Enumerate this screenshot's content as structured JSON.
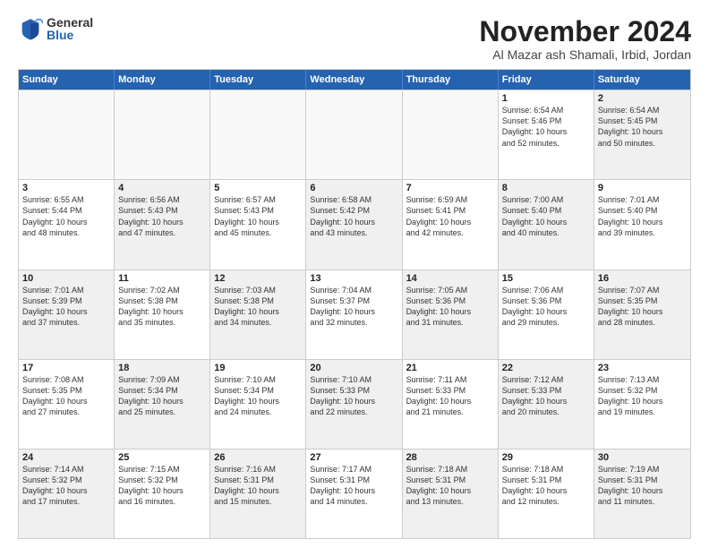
{
  "logo": {
    "general": "General",
    "blue": "Blue"
  },
  "title": "November 2024",
  "location": "Al Mazar ash Shamali, Irbid, Jordan",
  "headers": [
    "Sunday",
    "Monday",
    "Tuesday",
    "Wednesday",
    "Thursday",
    "Friday",
    "Saturday"
  ],
  "rows": [
    [
      {
        "day": "",
        "lines": [],
        "empty": true
      },
      {
        "day": "",
        "lines": [],
        "empty": true
      },
      {
        "day": "",
        "lines": [],
        "empty": true
      },
      {
        "day": "",
        "lines": [],
        "empty": true
      },
      {
        "day": "",
        "lines": [],
        "empty": true
      },
      {
        "day": "1",
        "lines": [
          "Sunrise: 6:54 AM",
          "Sunset: 5:46 PM",
          "Daylight: 10 hours",
          "and 52 minutes."
        ]
      },
      {
        "day": "2",
        "lines": [
          "Sunrise: 6:54 AM",
          "Sunset: 5:45 PM",
          "Daylight: 10 hours",
          "and 50 minutes."
        ],
        "shaded": true
      }
    ],
    [
      {
        "day": "3",
        "lines": [
          "Sunrise: 6:55 AM",
          "Sunset: 5:44 PM",
          "Daylight: 10 hours",
          "and 48 minutes."
        ]
      },
      {
        "day": "4",
        "lines": [
          "Sunrise: 6:56 AM",
          "Sunset: 5:43 PM",
          "Daylight: 10 hours",
          "and 47 minutes."
        ],
        "shaded": true
      },
      {
        "day": "5",
        "lines": [
          "Sunrise: 6:57 AM",
          "Sunset: 5:43 PM",
          "Daylight: 10 hours",
          "and 45 minutes."
        ]
      },
      {
        "day": "6",
        "lines": [
          "Sunrise: 6:58 AM",
          "Sunset: 5:42 PM",
          "Daylight: 10 hours",
          "and 43 minutes."
        ],
        "shaded": true
      },
      {
        "day": "7",
        "lines": [
          "Sunrise: 6:59 AM",
          "Sunset: 5:41 PM",
          "Daylight: 10 hours",
          "and 42 minutes."
        ]
      },
      {
        "day": "8",
        "lines": [
          "Sunrise: 7:00 AM",
          "Sunset: 5:40 PM",
          "Daylight: 10 hours",
          "and 40 minutes."
        ],
        "shaded": true
      },
      {
        "day": "9",
        "lines": [
          "Sunrise: 7:01 AM",
          "Sunset: 5:40 PM",
          "Daylight: 10 hours",
          "and 39 minutes."
        ]
      }
    ],
    [
      {
        "day": "10",
        "lines": [
          "Sunrise: 7:01 AM",
          "Sunset: 5:39 PM",
          "Daylight: 10 hours",
          "and 37 minutes."
        ],
        "shaded": true
      },
      {
        "day": "11",
        "lines": [
          "Sunrise: 7:02 AM",
          "Sunset: 5:38 PM",
          "Daylight: 10 hours",
          "and 35 minutes."
        ]
      },
      {
        "day": "12",
        "lines": [
          "Sunrise: 7:03 AM",
          "Sunset: 5:38 PM",
          "Daylight: 10 hours",
          "and 34 minutes."
        ],
        "shaded": true
      },
      {
        "day": "13",
        "lines": [
          "Sunrise: 7:04 AM",
          "Sunset: 5:37 PM",
          "Daylight: 10 hours",
          "and 32 minutes."
        ]
      },
      {
        "day": "14",
        "lines": [
          "Sunrise: 7:05 AM",
          "Sunset: 5:36 PM",
          "Daylight: 10 hours",
          "and 31 minutes."
        ],
        "shaded": true
      },
      {
        "day": "15",
        "lines": [
          "Sunrise: 7:06 AM",
          "Sunset: 5:36 PM",
          "Daylight: 10 hours",
          "and 29 minutes."
        ]
      },
      {
        "day": "16",
        "lines": [
          "Sunrise: 7:07 AM",
          "Sunset: 5:35 PM",
          "Daylight: 10 hours",
          "and 28 minutes."
        ],
        "shaded": true
      }
    ],
    [
      {
        "day": "17",
        "lines": [
          "Sunrise: 7:08 AM",
          "Sunset: 5:35 PM",
          "Daylight: 10 hours",
          "and 27 minutes."
        ]
      },
      {
        "day": "18",
        "lines": [
          "Sunrise: 7:09 AM",
          "Sunset: 5:34 PM",
          "Daylight: 10 hours",
          "and 25 minutes."
        ],
        "shaded": true
      },
      {
        "day": "19",
        "lines": [
          "Sunrise: 7:10 AM",
          "Sunset: 5:34 PM",
          "Daylight: 10 hours",
          "and 24 minutes."
        ]
      },
      {
        "day": "20",
        "lines": [
          "Sunrise: 7:10 AM",
          "Sunset: 5:33 PM",
          "Daylight: 10 hours",
          "and 22 minutes."
        ],
        "shaded": true
      },
      {
        "day": "21",
        "lines": [
          "Sunrise: 7:11 AM",
          "Sunset: 5:33 PM",
          "Daylight: 10 hours",
          "and 21 minutes."
        ]
      },
      {
        "day": "22",
        "lines": [
          "Sunrise: 7:12 AM",
          "Sunset: 5:33 PM",
          "Daylight: 10 hours",
          "and 20 minutes."
        ],
        "shaded": true
      },
      {
        "day": "23",
        "lines": [
          "Sunrise: 7:13 AM",
          "Sunset: 5:32 PM",
          "Daylight: 10 hours",
          "and 19 minutes."
        ]
      }
    ],
    [
      {
        "day": "24",
        "lines": [
          "Sunrise: 7:14 AM",
          "Sunset: 5:32 PM",
          "Daylight: 10 hours",
          "and 17 minutes."
        ],
        "shaded": true
      },
      {
        "day": "25",
        "lines": [
          "Sunrise: 7:15 AM",
          "Sunset: 5:32 PM",
          "Daylight: 10 hours",
          "and 16 minutes."
        ]
      },
      {
        "day": "26",
        "lines": [
          "Sunrise: 7:16 AM",
          "Sunset: 5:31 PM",
          "Daylight: 10 hours",
          "and 15 minutes."
        ],
        "shaded": true
      },
      {
        "day": "27",
        "lines": [
          "Sunrise: 7:17 AM",
          "Sunset: 5:31 PM",
          "Daylight: 10 hours",
          "and 14 minutes."
        ]
      },
      {
        "day": "28",
        "lines": [
          "Sunrise: 7:18 AM",
          "Sunset: 5:31 PM",
          "Daylight: 10 hours",
          "and 13 minutes."
        ],
        "shaded": true
      },
      {
        "day": "29",
        "lines": [
          "Sunrise: 7:18 AM",
          "Sunset: 5:31 PM",
          "Daylight: 10 hours",
          "and 12 minutes."
        ]
      },
      {
        "day": "30",
        "lines": [
          "Sunrise: 7:19 AM",
          "Sunset: 5:31 PM",
          "Daylight: 10 hours",
          "and 11 minutes."
        ],
        "shaded": true
      }
    ]
  ]
}
